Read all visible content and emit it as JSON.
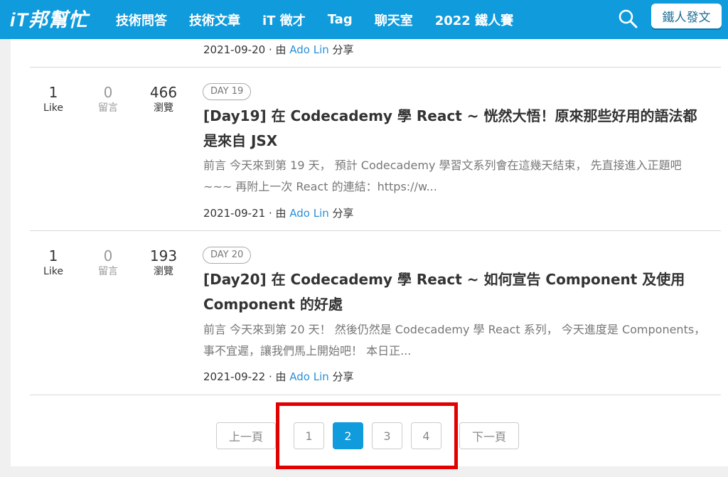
{
  "header": {
    "logo": "iT邦幫忙",
    "nav": [
      "技術問答",
      "技術文章",
      "iT 徵才",
      "Tag",
      "聊天室",
      "2022 鐵人賽"
    ],
    "post_button": "鐵人發文"
  },
  "prev_post_meta": {
    "date": "2021-09-20",
    "sep": " · 由 ",
    "author": "Ado Lin",
    "suffix": " 分享"
  },
  "posts": [
    {
      "likes": "1",
      "likes_label": "Like",
      "comments": "0",
      "comments_label": "留言",
      "views": "466",
      "views_label": "瀏覽",
      "badge": "DAY 19",
      "title": "[Day19] 在 Codecademy 學 React ~ 恍然大悟！原來那些好用的語法都是來自 JSX",
      "excerpt": "前言 今天來到第 19 天， 預計 Codecademy 學習文系列會在這幾天結束， 先直接進入正題吧~~~ 再附上一次 React 的連結：https://w...",
      "date": "2021-09-21",
      "sep": " · 由 ",
      "author": "Ado Lin",
      "suffix": " 分享"
    },
    {
      "likes": "1",
      "likes_label": "Like",
      "comments": "0",
      "comments_label": "留言",
      "views": "193",
      "views_label": "瀏覽",
      "badge": "DAY 20",
      "title": "[Day20] 在 Codecademy 學 React ~ 如何宣告 Component 及使用 Component 的好處",
      "excerpt": "前言 今天來到第 20 天！ 然後仍然是 Codecademy 學 React 系列， 今天進度是 Components， 事不宜遲，讓我們馬上開始吧！ 本日正...",
      "date": "2021-09-22",
      "sep": " · 由 ",
      "author": "Ado Lin",
      "suffix": " 分享"
    }
  ],
  "pagination": {
    "prev": "上一頁",
    "pages": [
      "1",
      "2",
      "3",
      "4"
    ],
    "current": "2",
    "next": "下一頁"
  },
  "colors": {
    "brand": "#0f9bdc",
    "highlight": "#e30000",
    "link": "#2a8fd6"
  }
}
